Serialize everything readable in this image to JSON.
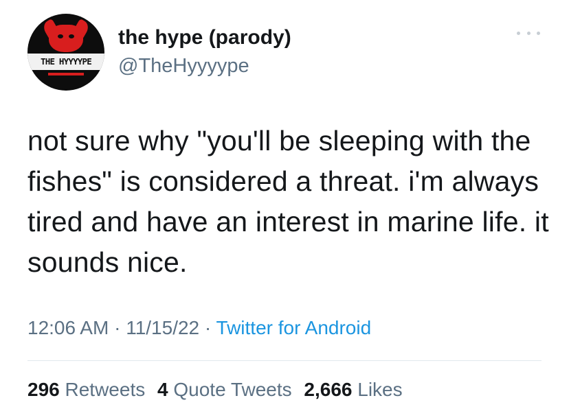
{
  "tweet": {
    "avatar": {
      "logo_text": "THE HYYYYPE",
      "icon": "devil-logo-icon"
    },
    "author": {
      "display_name": "the hype (parody)",
      "handle": "@TheHyyyype"
    },
    "more_icon": "ellipsis-icon",
    "text": "not sure why \"you'll be sleeping with the fishes\" is considered a threat. i'm always tired and have an interest in marine life. it sounds nice.",
    "time": "12:06 AM",
    "separator": "·",
    "date": "11/15/22",
    "source": "Twitter for Android",
    "stats": {
      "retweets_count": "296",
      "retweets_label": "Retweets",
      "quotes_count": "4",
      "quotes_label": "Quote Tweets",
      "likes_count": "2,666",
      "likes_label": "Likes"
    },
    "colors": {
      "text": "#14171a",
      "secondary": "#5b7083",
      "link": "#1b95e0",
      "avatar_red": "#d81e1e",
      "avatar_bg": "#0d0d0d"
    }
  }
}
